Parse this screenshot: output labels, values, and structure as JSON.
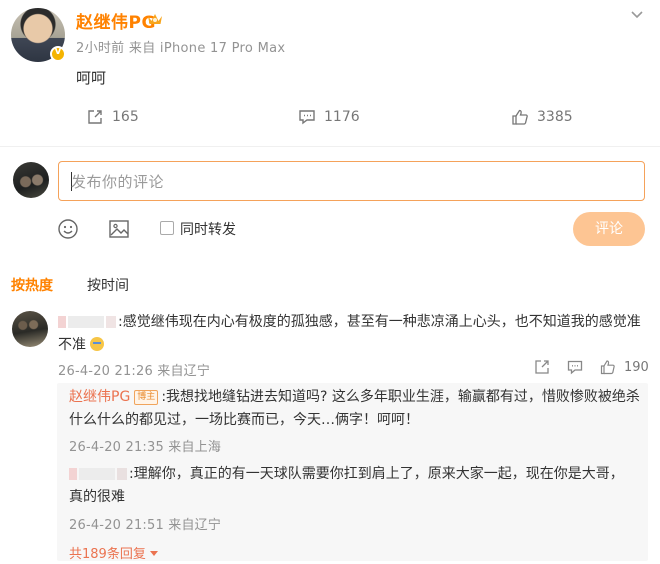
{
  "post": {
    "username": "赵继伟PG",
    "meta": "2小时前  来自 iPhone 17 Pro Max",
    "text": "呵呵",
    "repost_count": "165",
    "comment_count": "1176",
    "like_count": "3385"
  },
  "composer": {
    "placeholder": "发布你的评论",
    "repost_label": "同时转发",
    "submit_label": "评论"
  },
  "sort_tabs": [
    {
      "label": "按热度",
      "active": true
    },
    {
      "label": "按时间",
      "active": false
    }
  ],
  "comment": {
    "text": ":感觉继伟现在内心有极度的孤独感，甚至有一种悲凉涌上心头，也不知道我的感觉准",
    "text_cont": "不准",
    "meta": "26-4-20 21:26  来自辽宁",
    "like_count": "190"
  },
  "replies": [
    {
      "nick": "赵继伟PG",
      "badge": "博主",
      "text": ":我想找地缝钻进去知道吗? 这么多年职业生涯，输赢都有过，惜败惨败被绝杀",
      "text_cont": "什么什么的都见过，一场比赛而已，今天…俩字！呵呵！",
      "meta": "26-4-20 21:35  来自上海"
    },
    {
      "text": ":理解你，真正的有一天球队需要你扛到肩上了，原来大家一起，现在你是大哥，",
      "text_cont": "真的很难",
      "meta": "26-4-20 21:51  来自辽宁"
    }
  ],
  "more_replies": "共189条回复",
  "colors": {
    "accent": "#ff8200",
    "nick": "#eb7350",
    "submit_bg": "#fdc593",
    "input_border": "#f5a25a"
  }
}
